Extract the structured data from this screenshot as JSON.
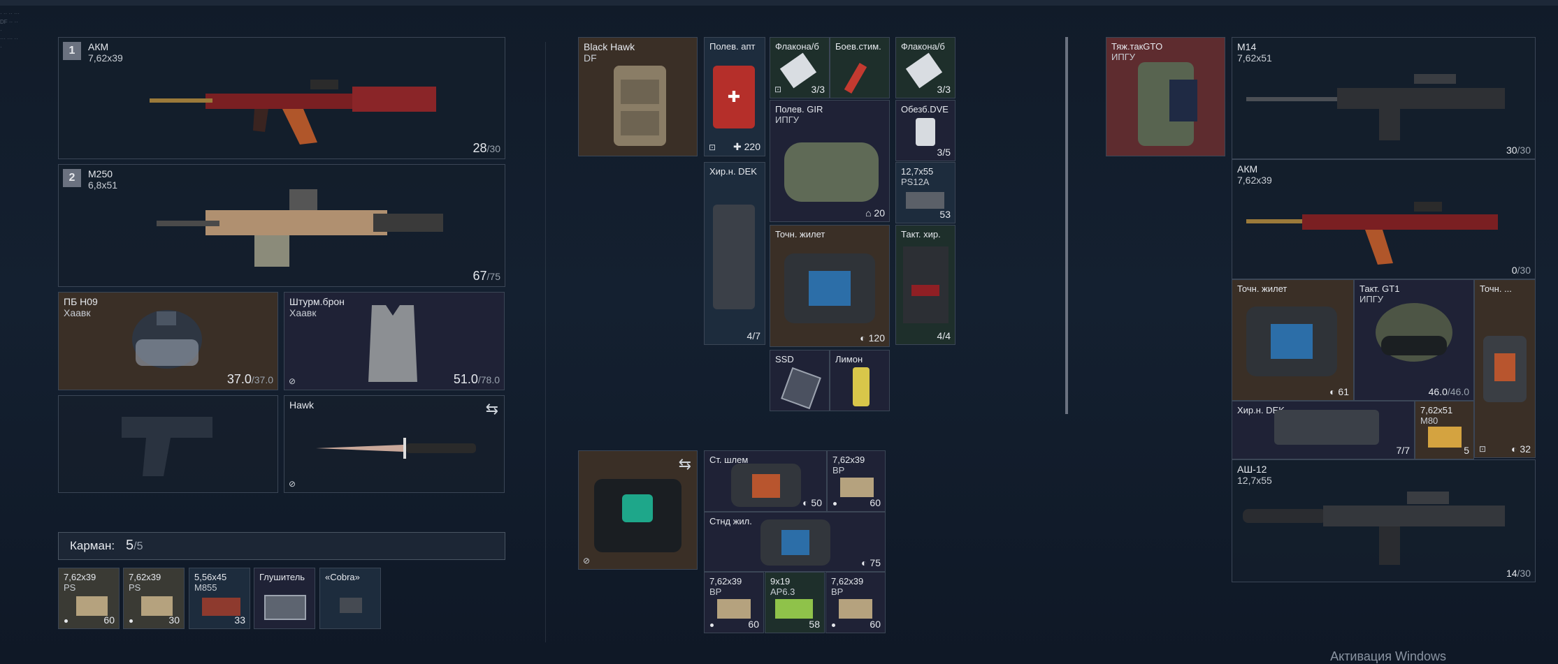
{
  "left": {
    "weapons": [
      {
        "slot": "1",
        "name": "АКМ",
        "caliber": "7,62х39",
        "ammo": "28",
        "cap": "30"
      },
      {
        "slot": "2",
        "name": "M250",
        "caliber": "6,8х51",
        "ammo": "67",
        "cap": "75"
      }
    ],
    "helmet": {
      "name": "ПБ Н09",
      "maker": "Хаавк",
      "dur": "37.0",
      "max": "37.0"
    },
    "armor": {
      "name": "Штурм.брон",
      "maker": "Хаавк",
      "dur": "51.0",
      "max": "78.0"
    },
    "knife": {
      "name": "Hawk"
    },
    "pocket": {
      "label": "Карман:",
      "count": "5",
      "max": "5"
    },
    "pocket_items": [
      {
        "name": "7,62х39",
        "sub": "PS",
        "qty": "60"
      },
      {
        "name": "7,62х39",
        "sub": "PS",
        "qty": "30"
      },
      {
        "name": "5,56х45",
        "sub": "M855",
        "qty": "33"
      },
      {
        "name": "Глушитель",
        "sub": "",
        "qty": ""
      },
      {
        "name": "«Cobra»",
        "sub": "",
        "qty": ""
      }
    ]
  },
  "middle": {
    "backpack": {
      "name": "Black Hawk",
      "sub": "DF"
    },
    "medkit": {
      "name": "Полев. апт",
      "qty": "220"
    },
    "flask1": {
      "name": "Флакон",
      "suffix": "а/б",
      "qty": "3/3"
    },
    "stim": {
      "name": "Боев.стим."
    },
    "flask2": {
      "name": "Флакон",
      "suffix": "а/б",
      "qty": "3/3"
    },
    "gir": {
      "name": "Полев. GIR",
      "sub": "ИПГУ",
      "qty": "20"
    },
    "obez": {
      "name": "Обезб.",
      "suffix": "DVE",
      "qty": "3/5"
    },
    "surgical": {
      "name": "Хир.н. DEK",
      "qty": "4/7"
    },
    "ammo127": {
      "name": "12,7х55",
      "sub": "PS12A",
      "qty": "53"
    },
    "vest": {
      "name": "Точн. жилет",
      "qty": "120"
    },
    "taktkhir": {
      "name": "Такт. хир.",
      "qty": "4/4"
    },
    "ssd": {
      "name": "SSD"
    },
    "lemon": {
      "name": "Лимон"
    },
    "container": {},
    "c_helmet": {
      "name": "Ст. шлем",
      "qty": "50"
    },
    "c_ammo1": {
      "name": "7,62х39",
      "sub": "BP",
      "qty": "60"
    },
    "c_vest": {
      "name": "Стнд жил.",
      "qty": "75"
    },
    "c_ammo2": {
      "name": "7,62х39",
      "sub": "BP",
      "qty": "60"
    },
    "c_ammo3": {
      "name": "9х19",
      "sub": "AP6.3",
      "qty": "58"
    },
    "c_ammo4": {
      "name": "7,62х39",
      "sub": "BP",
      "qty": "60"
    }
  },
  "right": {
    "backpack": {
      "name": "Тяж.такGTO",
      "sub": "ИПГУ"
    },
    "m14": {
      "name": "M14",
      "caliber": "7,62х51",
      "ammo": "30",
      "cap": "30"
    },
    "akm": {
      "name": "АКМ",
      "caliber": "7,62х39",
      "ammo": "0",
      "cap": "30"
    },
    "vest": {
      "name": "Точн. жилет",
      "qty": "61"
    },
    "helmet": {
      "name": "Такт. GT1",
      "sub": "ИПГУ",
      "dur": "46.0",
      "max": "46.0"
    },
    "tochn": {
      "name": "Точн. ...",
      "qty": "32"
    },
    "surgical": {
      "name": "Хир.н. DEK",
      "qty": "7/7"
    },
    "ammo": {
      "name": "7,62х51",
      "sub": "M80",
      "qty": "5"
    },
    "ash": {
      "name": "АШ-12",
      "caliber": "12,7х55",
      "ammo": "14",
      "cap": "30"
    }
  },
  "watermark": "Активация Windows"
}
